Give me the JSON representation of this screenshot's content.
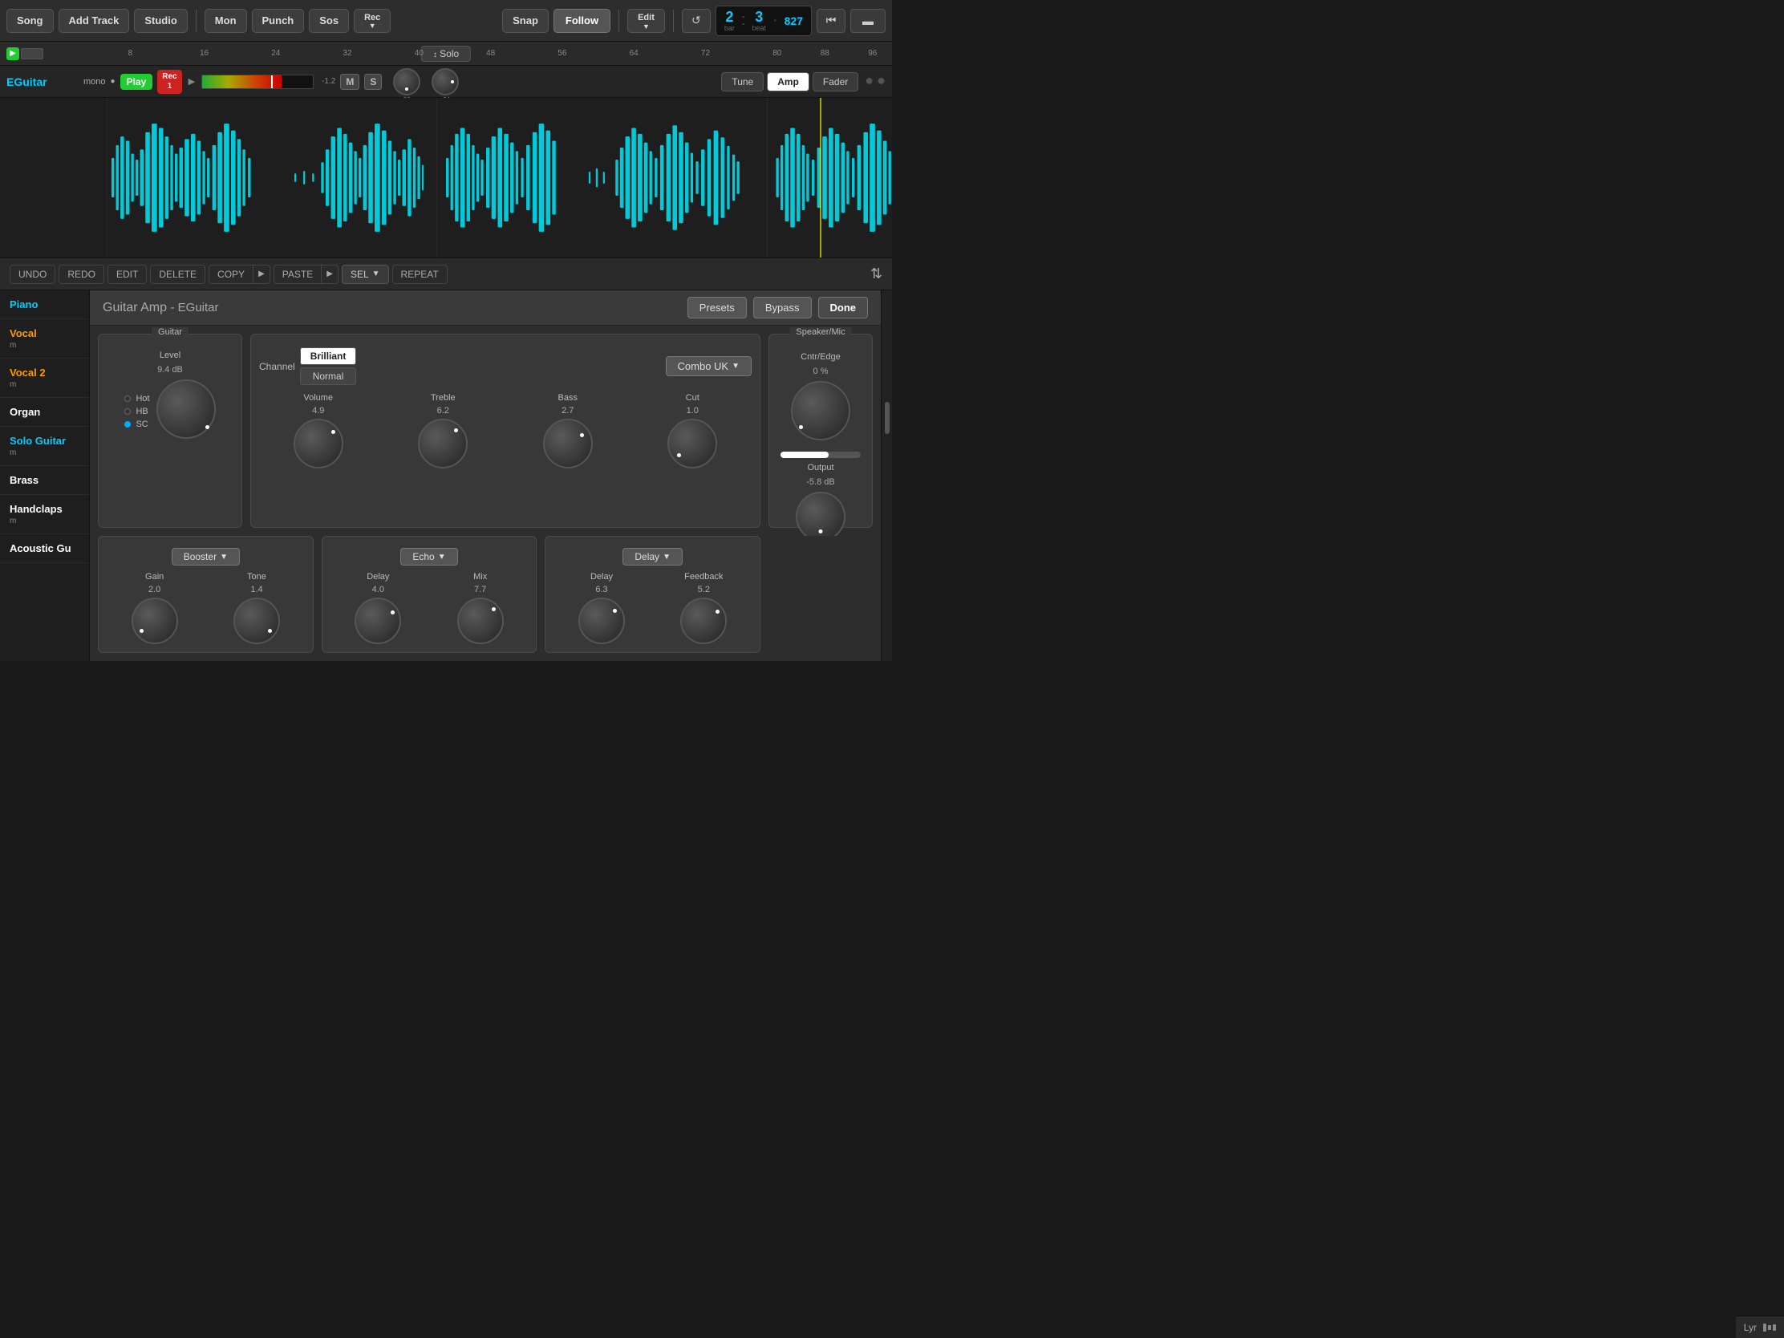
{
  "topbar": {
    "song_label": "Song",
    "add_track_label": "Add Track",
    "studio_label": "Studio",
    "mon_label": "Mon",
    "punch_label": "Punch",
    "sos_label": "Sos",
    "rec_label": "Rec",
    "snap_label": "Snap",
    "follow_label": "Follow",
    "edit_label": "Edit",
    "bar_num": "2",
    "beat_num": "3",
    "sub_beat": "827",
    "bar_label": "bar",
    "beat_label": "beat"
  },
  "timeline": {
    "solo_label": "Solo",
    "marks": [
      "8",
      "16",
      "24",
      "32",
      "40",
      "48",
      "56",
      "64",
      "72",
      "80",
      "88",
      "96"
    ]
  },
  "track": {
    "name": "EGuitar",
    "mono_label": "mono",
    "play_label": "Play",
    "rec_label": "Rec\n1",
    "tune_label": "Tune",
    "amp_label": "Amp",
    "fader_label": "Fader",
    "m_label": "M",
    "s_label": "S"
  },
  "edit_toolbar": {
    "undo_label": "UNDO",
    "redo_label": "REDO",
    "edit_label": "EDIT",
    "delete_label": "DELETE",
    "copy_label": "COPY",
    "paste_label": "PASTE",
    "sel_label": "SEL",
    "repeat_label": "REPEAT"
  },
  "sidebar": {
    "items": [
      {
        "name": "Piano",
        "class": "piano",
        "sub": ""
      },
      {
        "name": "Vocal",
        "class": "vocal",
        "sub": "m"
      },
      {
        "name": "Vocal 2",
        "class": "vocal2",
        "sub": "m"
      },
      {
        "name": "Organ",
        "class": "organ",
        "sub": ""
      },
      {
        "name": "Solo Guitar",
        "class": "solo-guitar",
        "sub": "m"
      },
      {
        "name": "Brass",
        "class": "brass",
        "sub": ""
      },
      {
        "name": "Handclaps",
        "class": "handclaps",
        "sub": "m"
      },
      {
        "name": "Acoustic Gu",
        "class": "acoustic",
        "sub": ""
      }
    ]
  },
  "guitar_amp": {
    "title": "Guitar Amp",
    "subtitle": "- EGuitar",
    "presets_label": "Presets",
    "bypass_label": "Bypass",
    "done_label": "Done",
    "guitar_section_label": "Guitar",
    "level_label": "Level",
    "level_value": "9.4 dB",
    "hot_label": "Hot",
    "hb_label": "HB",
    "sc_label": "SC",
    "amp_preset": "Combo UK",
    "channel_label": "Channel",
    "amp_section_label": "",
    "speaker_section_label": "Speaker/Mic",
    "cntr_edge_label": "Cntr/Edge",
    "cntr_edge_value": "0 %",
    "output_label": "Output",
    "output_value": "-5.8 dB",
    "channel_options": [
      "Brilliant",
      "Normal"
    ],
    "amp_knobs": [
      {
        "label": "Volume",
        "value": "4.9",
        "angle": 0
      },
      {
        "label": "Treble",
        "value": "6.2",
        "angle": 30
      },
      {
        "label": "Bass",
        "value": "2.7",
        "angle": -60
      },
      {
        "label": "Cut",
        "value": "1.0",
        "angle": -80
      }
    ],
    "booster_label": "Booster",
    "booster_knobs": [
      {
        "label": "Gain",
        "value": "2.0"
      },
      {
        "label": "Tone",
        "value": "1.4"
      }
    ],
    "echo_label": "Echo",
    "echo_knobs": [
      {
        "label": "Delay",
        "value": "4.0"
      },
      {
        "label": "Mix",
        "value": "7.7"
      }
    ],
    "delay_label": "Delay",
    "delay_knobs": [
      {
        "label": "Delay",
        "value": "6.3"
      },
      {
        "label": "Feedback",
        "value": "5.2"
      }
    ]
  },
  "bottom_icons": {
    "lyr_label": "Lyr"
  }
}
